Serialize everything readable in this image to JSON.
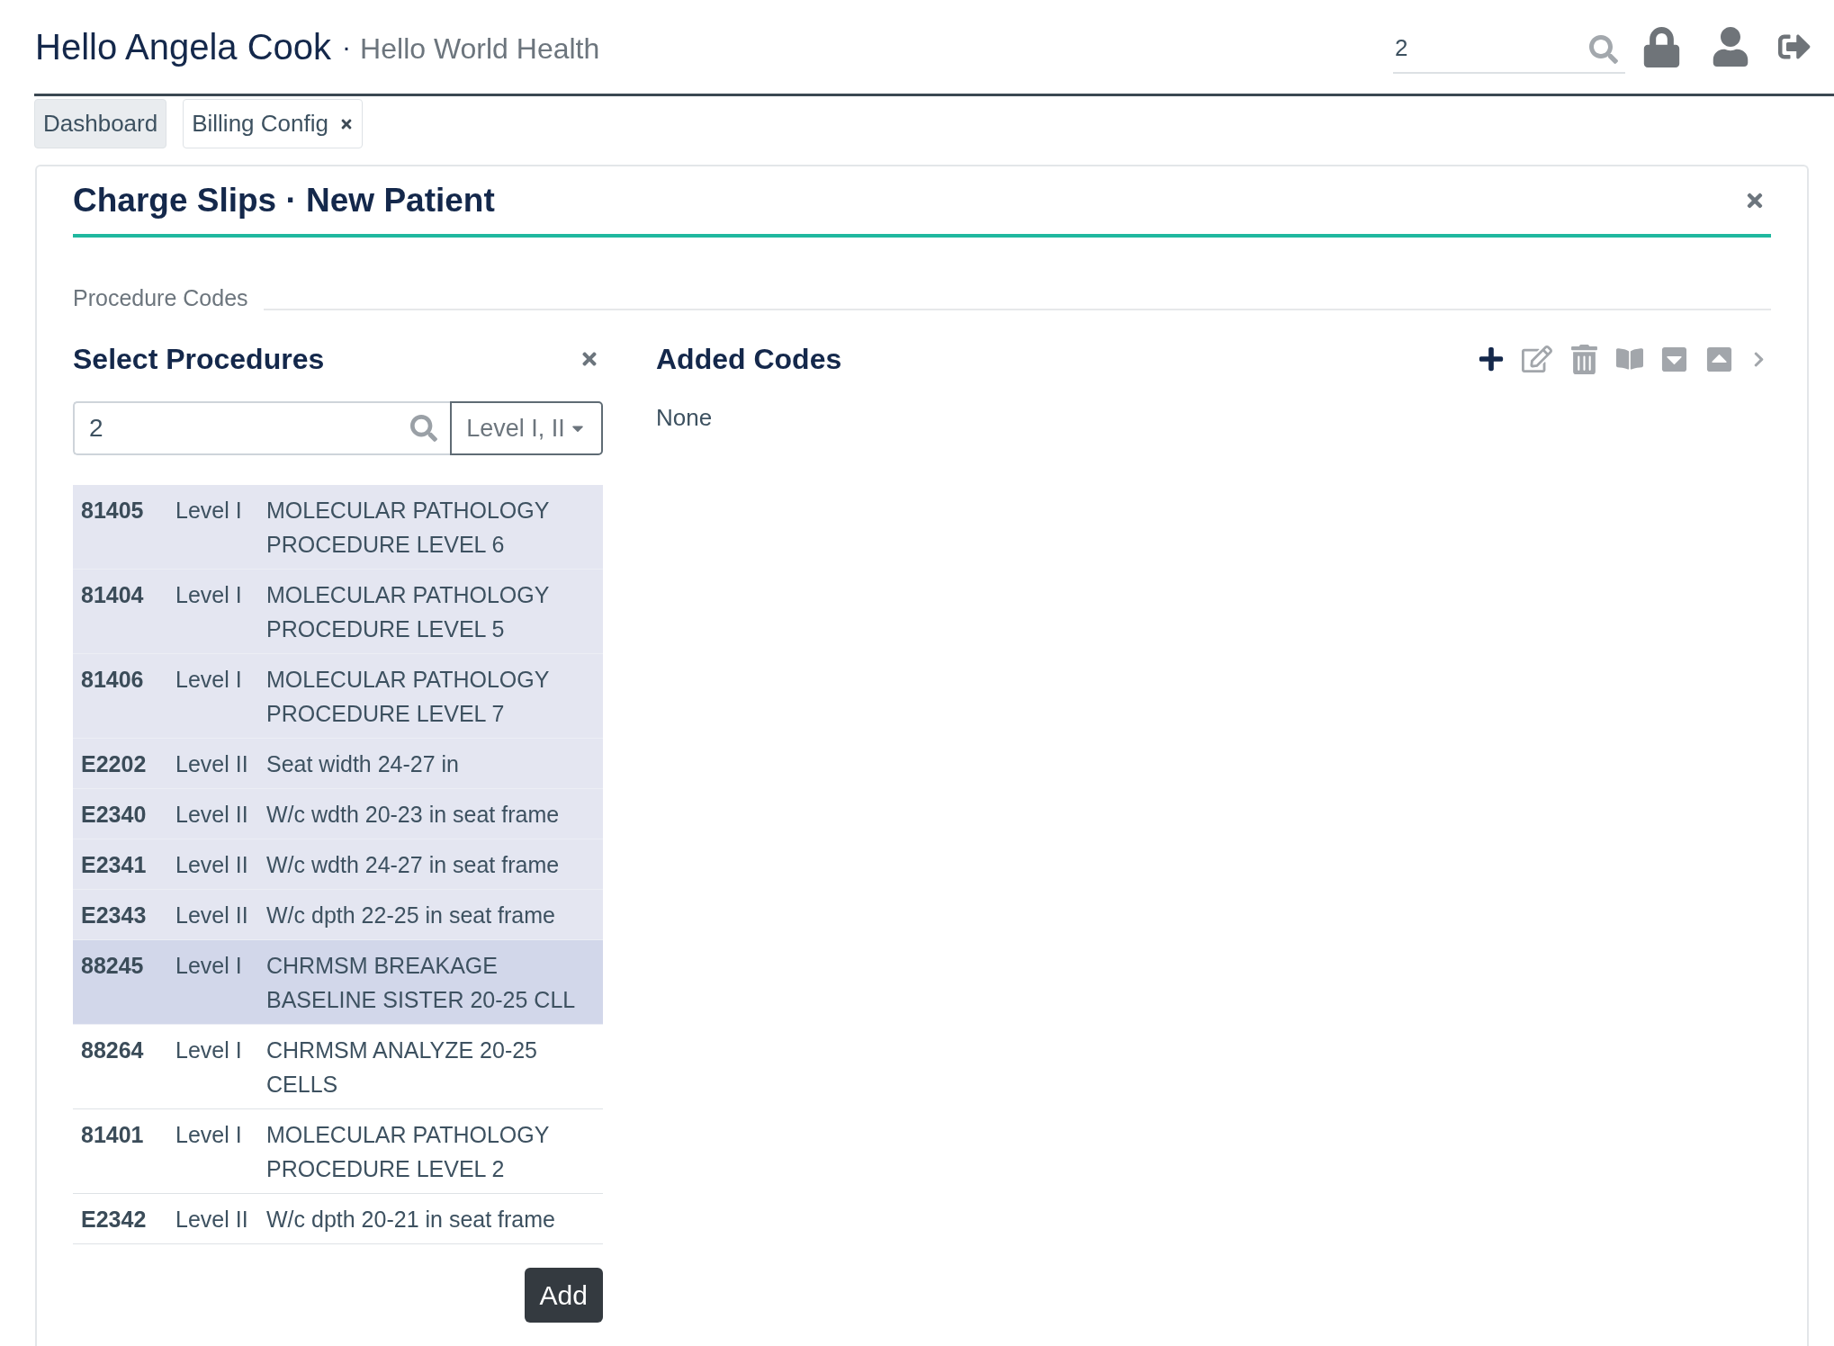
{
  "header": {
    "greeting": "Hello Angela Cook",
    "separator": "·",
    "organization": "Hello World Health",
    "search": {
      "value": "2"
    }
  },
  "tabs": [
    {
      "label": "Dashboard",
      "selected": false,
      "closable": false
    },
    {
      "label": "Billing Config",
      "selected": true,
      "closable": true
    }
  ],
  "card": {
    "title": "Charge Slips · New Patient",
    "section_label": "Procedure Codes"
  },
  "select_procedures": {
    "title": "Select Procedures",
    "search": {
      "value": "2"
    },
    "level_filter": "Level I, II",
    "rows": [
      {
        "code": "81405",
        "level": "Level I",
        "description": "MOLECULAR PATHOLOGY PROCEDURE LEVEL 6",
        "selected": true,
        "highlighted": false
      },
      {
        "code": "81404",
        "level": "Level I",
        "description": "MOLECULAR PATHOLOGY PROCEDURE LEVEL 5",
        "selected": true,
        "highlighted": false
      },
      {
        "code": "81406",
        "level": "Level I",
        "description": "MOLECULAR PATHOLOGY PROCEDURE LEVEL 7",
        "selected": true,
        "highlighted": false
      },
      {
        "code": "E2202",
        "level": "Level II",
        "description": "Seat width 24-27 in",
        "selected": true,
        "highlighted": false
      },
      {
        "code": "E2340",
        "level": "Level II",
        "description": "W/c wdth 20-23 in seat frame",
        "selected": true,
        "highlighted": false
      },
      {
        "code": "E2341",
        "level": "Level II",
        "description": "W/c wdth 24-27 in seat frame",
        "selected": true,
        "highlighted": false
      },
      {
        "code": "E2343",
        "level": "Level II",
        "description": "W/c dpth 22-25 in seat frame",
        "selected": true,
        "highlighted": false
      },
      {
        "code": "88245",
        "level": "Level I",
        "description": "CHRMSM BREAKAGE BASELINE SISTER 20-25 CLL",
        "selected": true,
        "highlighted": true
      },
      {
        "code": "88264",
        "level": "Level I",
        "description": "CHRMSM ANALYZE 20-25 CELLS",
        "selected": false,
        "highlighted": false
      },
      {
        "code": "81401",
        "level": "Level I",
        "description": "MOLECULAR PATHOLOGY PROCEDURE LEVEL 2",
        "selected": false,
        "highlighted": false
      },
      {
        "code": "E2342",
        "level": "Level II",
        "description": "W/c dpth 20-21 in seat frame",
        "selected": false,
        "highlighted": false
      }
    ],
    "add_button": "Add"
  },
  "added_codes": {
    "title": "Added Codes",
    "empty_text": "None",
    "toolbar": [
      {
        "kind": "add",
        "disabled": false
      },
      {
        "kind": "edit",
        "disabled": true
      },
      {
        "kind": "delete",
        "disabled": true
      },
      {
        "kind": "book",
        "disabled": true
      },
      {
        "kind": "collapse",
        "disabled": true
      },
      {
        "kind": "expand",
        "disabled": true
      },
      {
        "kind": "next",
        "disabled": true
      }
    ]
  }
}
